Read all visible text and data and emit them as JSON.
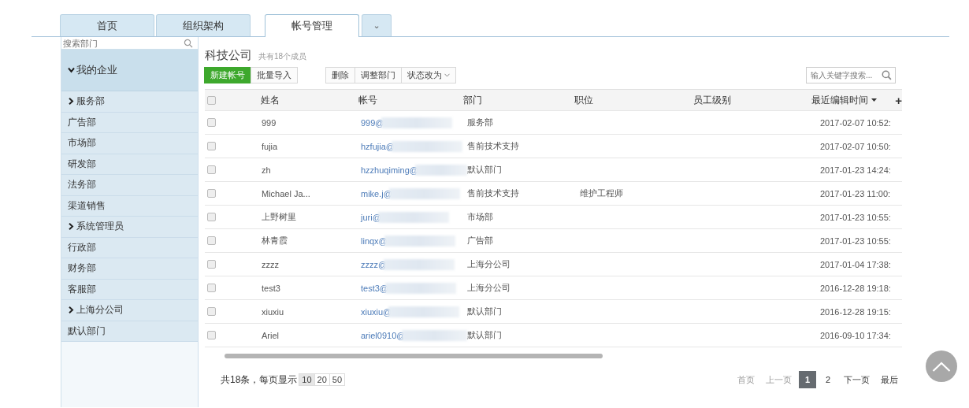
{
  "tabs": [
    {
      "label": "首页",
      "selected": false
    },
    {
      "label": "组织架构",
      "selected": false
    },
    {
      "label": "帐号管理",
      "selected": true
    },
    {
      "label": "⌄",
      "selected": false,
      "kind": "menu"
    }
  ],
  "sidebar": {
    "search": {
      "placeholder": "搜索部门"
    },
    "tree": [
      {
        "label": "我的企业",
        "expanded": true,
        "children": [
          {
            "label": "服务部",
            "expanded": false
          },
          {
            "label": "广告部"
          },
          {
            "label": "市场部"
          },
          {
            "label": "研发部"
          },
          {
            "label": "法务部"
          },
          {
            "label": "渠道销售"
          },
          {
            "label": "系统管理员",
            "expanded": false
          },
          {
            "label": "行政部"
          },
          {
            "label": "财务部"
          },
          {
            "label": "客服部"
          },
          {
            "label": "上海分公司",
            "expanded": false
          },
          {
            "label": "默认部门"
          }
        ]
      }
    ]
  },
  "header": {
    "title": "科技公司",
    "subtitle": "共有18个成员"
  },
  "toolbar": {
    "primary": [
      {
        "label": "新建帐号",
        "kind": "primary"
      },
      {
        "label": "批量导入",
        "kind": "default"
      }
    ],
    "actions": [
      {
        "label": "删除",
        "dropdown": false
      },
      {
        "label": "调整部门",
        "dropdown": false
      },
      {
        "label": "状态改为",
        "dropdown": true
      }
    ],
    "search": {
      "placeholder": "输入关键字搜索..."
    }
  },
  "table": {
    "columns": [
      {
        "label": "姓名",
        "sorted": false
      },
      {
        "label": "帐号",
        "sorted": false
      },
      {
        "label": "部门",
        "sorted": false
      },
      {
        "label": "职位",
        "sorted": false
      },
      {
        "label": "员工级别",
        "sorted": false
      },
      {
        "label": "最近编辑时间",
        "sorted": true
      }
    ],
    "add_column": "+",
    "header_checked": false,
    "rows": [
      {
        "checked": false,
        "cells": [
          "999",
          "999@",
          "服务部",
          "",
          "",
          "2017-02-07 10:52:"
        ]
      },
      {
        "checked": false,
        "cells": [
          "fujia",
          "hzfujia@",
          "售前技术支持",
          "",
          "",
          "2017-02-07 10:50:"
        ]
      },
      {
        "checked": false,
        "cells": [
          "zh",
          "hzzhuqiming@",
          "默认部门",
          "",
          "",
          "2017-01-23 14:24:"
        ]
      },
      {
        "checked": false,
        "cells": [
          "Michael Ja...",
          "mike.j@",
          "售前技术支持",
          "维护工程师",
          "",
          "2017-01-23 11:00:"
        ]
      },
      {
        "checked": false,
        "cells": [
          "上野树里",
          "juri@",
          "市场部",
          "",
          "",
          "2017-01-23 10:55:"
        ]
      },
      {
        "checked": false,
        "cells": [
          "林青霞",
          "linqx@",
          "广告部",
          "",
          "",
          "2017-01-23 10:55:"
        ]
      },
      {
        "checked": false,
        "cells": [
          "zzzz",
          "zzzz@",
          "上海分公司",
          "",
          "",
          "2017-01-04 17:38:"
        ]
      },
      {
        "checked": false,
        "cells": [
          "test3",
          "test3@",
          "上海分公司",
          "",
          "",
          "2016-12-28 19:18:"
        ]
      },
      {
        "checked": false,
        "cells": [
          "xiuxiu",
          "xiuxiu@",
          "默认部门",
          "",
          "",
          "2016-12-28 19:15:"
        ]
      },
      {
        "checked": false,
        "cells": [
          "Ariel",
          "ariel0910@",
          "默认部门",
          "",
          "",
          "2016-09-10 17:34:"
        ]
      }
    ]
  },
  "footer": {
    "total": "共18条，每页显示",
    "page_sizes": [
      {
        "label": "10",
        "selected": true
      },
      {
        "label": "20",
        "selected": false
      },
      {
        "label": "50",
        "selected": false
      }
    ],
    "pagination": [
      {
        "label": "首页",
        "kind": "nav",
        "disabled": true
      },
      {
        "label": "上一页",
        "kind": "nav",
        "disabled": true
      },
      {
        "label": "1",
        "kind": "page",
        "selected": true
      },
      {
        "label": "2",
        "kind": "page",
        "selected": false
      },
      {
        "label": "下一页",
        "kind": "nav",
        "disabled": false
      },
      {
        "label": "最后",
        "kind": "nav",
        "disabled": false
      }
    ]
  }
}
